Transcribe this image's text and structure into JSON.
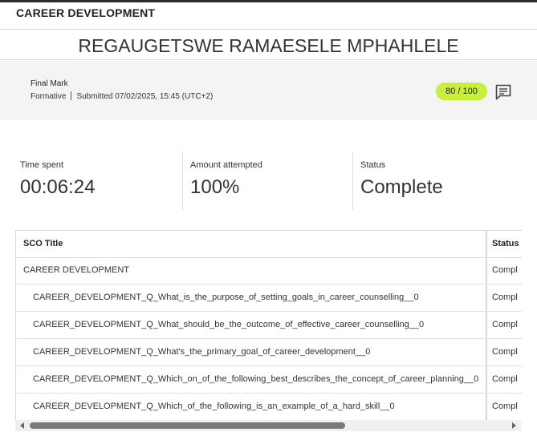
{
  "header": {
    "title": "CAREER DEVELOPMENT"
  },
  "student": {
    "name": "REGAUGETSWE RAMAESELE MPHAHLELE"
  },
  "final_mark": {
    "label": "Final Mark",
    "type": "Formative",
    "submitted": "Submitted 07/02/2025, 15:45 (UTC+2)",
    "score": "80 / 100",
    "feedback_icon": "comment-icon"
  },
  "stats": [
    {
      "label": "Time spent",
      "value": "00:06:24"
    },
    {
      "label": "Amount attempted",
      "value": "100%"
    },
    {
      "label": "Status",
      "value": "Complete"
    }
  ],
  "table": {
    "columns": [
      "SCO Title",
      "Status"
    ],
    "rows": [
      {
        "title": "CAREER DEVELOPMENT",
        "status": "Compl"
      },
      {
        "title": "CAREER_DEVELOPMENT_Q_What_is_the_purpose_of_setting_goals_in_career_counselling__0",
        "status": "Compl"
      },
      {
        "title": "CAREER_DEVELOPMENT_Q_What_should_be_the_outcome_of_effective_career_counselling__0",
        "status": "Compl"
      },
      {
        "title": "CAREER_DEVELOPMENT_Q_What's_the_primary_goal_of_career_development__0",
        "status": "Compl"
      },
      {
        "title": "CAREER_DEVELOPMENT_Q_Which_on_of_the_following_best_describes_the_concept_of_career_planning__0",
        "status": "Compl"
      },
      {
        "title": "CAREER_DEVELOPMENT_Q_Which_of_the_following_is_an_example_of_a_hard_skill__0",
        "status": "Compl"
      }
    ]
  },
  "colors": {
    "score_pill": "#c8ef3c",
    "panel_bg": "#f4f4f4",
    "header_strip": "#2b2b2b"
  }
}
